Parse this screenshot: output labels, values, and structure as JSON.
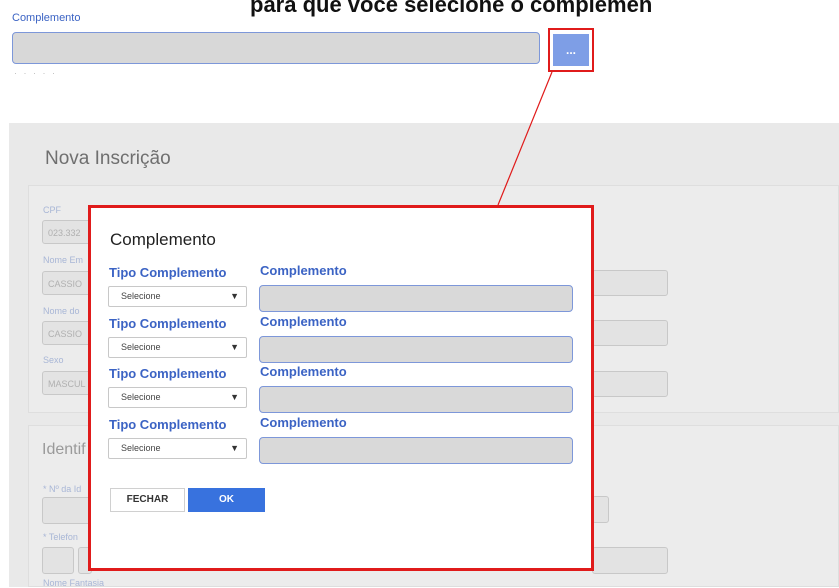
{
  "top": {
    "caption": "para que você selecione o complemen",
    "label": "Complemento",
    "button_label": "..."
  },
  "background": {
    "page_title": "Nova Inscrição",
    "labels": [
      "CPF",
      "Nome Em",
      "Nome do",
      "Sexo"
    ],
    "values": [
      "023.332",
      "CASSIO",
      "CASSIO",
      "MASCUL"
    ],
    "section_title": "Identif",
    "labels2": [
      "* Nº da Id",
      "* Telefon",
      "Nome Fantasia"
    ]
  },
  "modal": {
    "title": "Complemento",
    "rows": [
      {
        "tipo_label": "Tipo Complemento",
        "comp_label": "Complemento",
        "select_value": "Selecione"
      },
      {
        "tipo_label": "Tipo Complemento",
        "comp_label": "Complemento",
        "select_value": "Selecione"
      },
      {
        "tipo_label": "Tipo Complemento",
        "comp_label": "Complemento",
        "select_value": "Selecione"
      },
      {
        "tipo_label": "Tipo Complemento",
        "comp_label": "Complemento",
        "select_value": "Selecione"
      }
    ],
    "fechar_label": "FECHAR",
    "ok_label": "OK"
  },
  "colors": {
    "accent": "#3b63c4",
    "highlight": "#e01b1b",
    "ok_button": "#3872de"
  }
}
